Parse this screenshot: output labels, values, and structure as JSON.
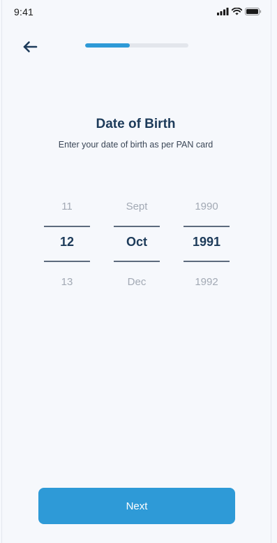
{
  "status_bar": {
    "time": "9:41"
  },
  "header": {
    "back_icon": "arrow-left-icon",
    "progress_fraction": 0.43
  },
  "page": {
    "title": "Date of Birth",
    "subtitle": "Enter your date of birth as per PAN card"
  },
  "picker": {
    "day": {
      "prev": "11",
      "selected": "12",
      "next": "13"
    },
    "month": {
      "prev": "Sept",
      "selected": "Oct",
      "next": "Dec"
    },
    "year": {
      "prev": "1990",
      "selected": "1991",
      "next": "1992"
    }
  },
  "footer": {
    "next_label": "Next"
  },
  "colors": {
    "accent": "#2e9ad7",
    "heading": "#1d3b5a",
    "muted": "#a2a9b4",
    "background": "#f6f8fc"
  }
}
